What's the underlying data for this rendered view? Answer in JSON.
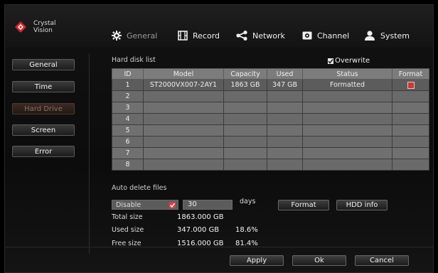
{
  "brand": {
    "line1": "Crystal",
    "line2": "Vision"
  },
  "nav": [
    {
      "label": "General",
      "icon": "gear-icon",
      "dim": true
    },
    {
      "label": "Record",
      "icon": "film-icon",
      "dim": false
    },
    {
      "label": "Network",
      "icon": "network-share-icon",
      "dim": false
    },
    {
      "label": "Channel",
      "icon": "camera-icon",
      "dim": false
    },
    {
      "label": "System",
      "icon": "user-icon",
      "dim": false
    }
  ],
  "sidebar": [
    {
      "label": "General",
      "active": false
    },
    {
      "label": "Time",
      "active": false
    },
    {
      "label": "Hard Drive",
      "active": true
    },
    {
      "label": "Screen",
      "active": false
    },
    {
      "label": "Error",
      "active": false
    }
  ],
  "disk_list": {
    "title": "Hard disk list",
    "overwrite_label": "Overwrite",
    "overwrite_checked": true,
    "columns": [
      "ID",
      "Model",
      "Capacity",
      "Used",
      "Status",
      "Format"
    ],
    "rows": [
      {
        "id": "1",
        "model": "ST2000VX007-2AY1",
        "capacity": "1863 GB",
        "used": "347 GB",
        "status": "Formatted",
        "format": true
      },
      {
        "id": "2",
        "model": "",
        "capacity": "",
        "used": "",
        "status": "",
        "format": false
      },
      {
        "id": "3",
        "model": "",
        "capacity": "",
        "used": "",
        "status": "",
        "format": false
      },
      {
        "id": "4",
        "model": "",
        "capacity": "",
        "used": "",
        "status": "",
        "format": false
      },
      {
        "id": "5",
        "model": "",
        "capacity": "",
        "used": "",
        "status": "",
        "format": false
      },
      {
        "id": "6",
        "model": "",
        "capacity": "",
        "used": "",
        "status": "",
        "format": false
      },
      {
        "id": "7",
        "model": "",
        "capacity": "",
        "used": "",
        "status": "",
        "format": false
      },
      {
        "id": "8",
        "model": "",
        "capacity": "",
        "used": "",
        "status": "",
        "format": false
      }
    ]
  },
  "auto_delete": {
    "title": "Auto delete files",
    "mode": "Disable",
    "days_value": "30",
    "days_unit": "days",
    "format_button": "Format",
    "hdd_info_button": "HDD info"
  },
  "stats": {
    "total_label": "Total size",
    "total_value": "1863.000 GB",
    "used_label": "Used size",
    "used_value": "347.000 GB",
    "used_pct": "18.6%",
    "free_label": "Free size",
    "free_value": "1516.000 GB",
    "free_pct": "81.4%"
  },
  "footer": {
    "apply": "Apply",
    "ok": "Ok",
    "cancel": "Cancel"
  },
  "colors": {
    "accent_red": "#c63a3a",
    "header_bg": "#7c7c7c"
  }
}
